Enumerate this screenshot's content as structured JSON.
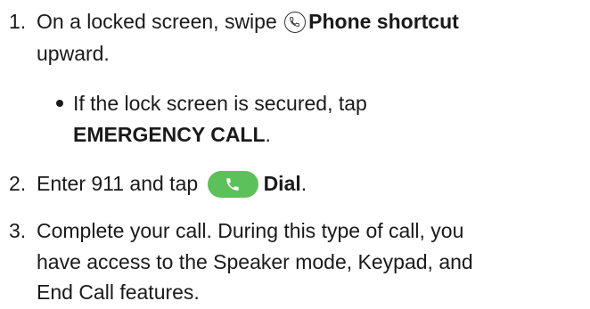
{
  "step1": {
    "number": "1.",
    "text_before": "On a locked screen, swipe",
    "shortcut_name": "Phone shortcut",
    "line2": "upward.",
    "shortcut_icon": "phone-handset-icon"
  },
  "bullet": {
    "line1": "If the lock screen is secured, tap",
    "button_label": "EMERGENCY CALL",
    "period": "."
  },
  "step2": {
    "number": "2.",
    "text_before": "Enter 911 and tap",
    "dial_label": "Dial",
    "period": ".",
    "dial_icon": "phone-handset-icon",
    "dial_color": "#5cc15a"
  },
  "step3": {
    "number": "3.",
    "line1": "Complete your call. During this type of call, you",
    "line2": "have access to the Speaker mode, Keypad, and",
    "line3": "End Call features."
  }
}
